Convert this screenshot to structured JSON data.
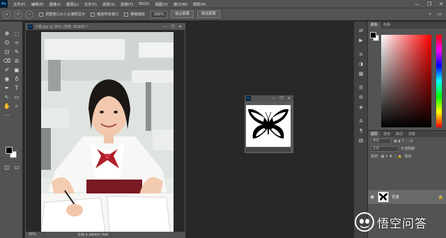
{
  "app": {
    "logo": "Ps"
  },
  "menubar": {
    "items": [
      "文件(F)",
      "编辑(E)",
      "图像(I)",
      "图层(L)",
      "文字(Y)",
      "选择(S)",
      "滤镜(T)",
      "3D(D)",
      "视图(V)",
      "窗口(W)",
      "帮助(H)"
    ],
    "window_controls": {
      "minimize": "—",
      "restore": "❐",
      "close": "✕"
    }
  },
  "options_bar": {
    "tool_icon": "zoom-icon",
    "zoom_in": "+",
    "zoom_out": "−",
    "resize_windows_label": "调整窗口大小以满屏显示",
    "zoom_all_windows_label": "缩放所有窗口",
    "scrubby_zoom_label": "细微缩放",
    "zoom_value": "100%",
    "fit_screen_label": "适合屏幕",
    "fill_screen_label": "填充屏幕",
    "search": "⌕",
    "workspace": "▭"
  },
  "tools": [
    "✥",
    "⬚",
    "ʘ",
    "⌗",
    "⊡",
    "✎",
    "⌫",
    "⊘",
    "✐",
    "▣",
    "◉",
    "♁",
    "✒",
    "T",
    "↖",
    "▭",
    "✋",
    "⌕",
    "⋯"
  ],
  "document_main": {
    "title": "人物.jpg @ 38% (背景, RGB/8) *",
    "zoom": "38%",
    "doc_size": "文档:4.88M/9.76M",
    "controls": {
      "minimize": "—",
      "restore": "❐",
      "close": "✕"
    }
  },
  "document_butterfly": {
    "controls": {
      "minimize": "—",
      "restore": "❐",
      "close": "✕"
    }
  },
  "dock_icons": [
    "⇄",
    "▶",
    "≡",
    "◑",
    "▦",
    "☰",
    "⚙",
    "◈",
    "A",
    "¶",
    "▤"
  ],
  "color_panel": {
    "tabs": [
      "颜色",
      "色板"
    ],
    "foreground": "#000000",
    "background": "#ffffff",
    "hue": "#ff0000"
  },
  "layers_panel": {
    "tabs": [
      "图层",
      "通道",
      "路径",
      "调整"
    ],
    "kind_filter": "类型",
    "blend_mode": "正常",
    "opacity_label": "不透明度:",
    "lock_label": "锁定:",
    "fill_label": "填充:",
    "layer": {
      "name": "背景",
      "visible": "◉",
      "lock": "🔒"
    }
  },
  "watermark": {
    "text": "悟空问答"
  }
}
